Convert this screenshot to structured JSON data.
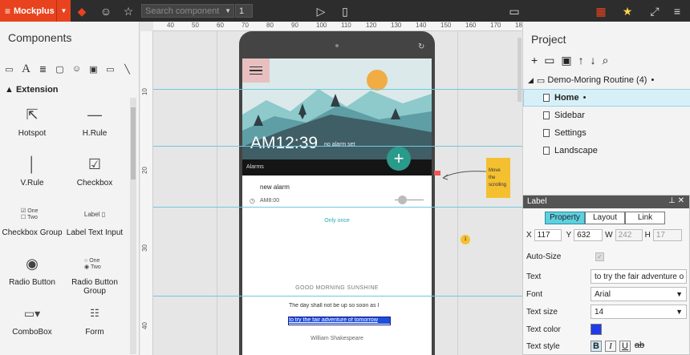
{
  "app": {
    "name": "Mockplus"
  },
  "toolbar": {
    "search_placeholder": "Search component",
    "page_number": "1"
  },
  "left": {
    "title": "Components",
    "section": "Extension",
    "items": [
      {
        "label": "Hotspot",
        "icon": "cursor-icon"
      },
      {
        "label": "H.Rule",
        "icon": "hrule-icon"
      },
      {
        "label": "V.Rule",
        "icon": "vrule-icon"
      },
      {
        "label": "Checkbox",
        "icon": "checkbox-icon"
      },
      {
        "label": "Checkbox Group",
        "icon": "checkbox-group-icon"
      },
      {
        "label": "Label Text Input",
        "icon": "label-input-icon"
      },
      {
        "label": "Radio Button",
        "icon": "radio-icon"
      },
      {
        "label": "Radio Button Group",
        "icon": "radio-group-icon"
      },
      {
        "label": "ComboBox",
        "icon": "combobox-icon"
      },
      {
        "label": "Form",
        "icon": "form-icon"
      }
    ],
    "cbg_one": "One",
    "cbg_two": "Two",
    "label_word": "Label",
    "rbg_one": "One",
    "rbg_two": "Two"
  },
  "ruler": {
    "top": [
      "40",
      "50",
      "60",
      "70",
      "80",
      "90",
      "100",
      "110",
      "120",
      "130",
      "140",
      "150",
      "160",
      "170",
      "180"
    ],
    "left": [
      "10",
      "20",
      "30",
      "40"
    ]
  },
  "phone": {
    "time": "AM12:39",
    "no_alarm": "no alarm set",
    "alarms_bar": "Alarms",
    "new_alarm": "new alarm",
    "alarm_time": "AM8:00",
    "only_once": "Only once",
    "headline": "GOOD MORNING SUNSHINE",
    "quote1": "The day shall not be up so soon as I",
    "quote2": "to try the fair adventure of tomorrow",
    "author": "William Shakespeare",
    "fab": "+"
  },
  "note": {
    "text": "Move the scrolling"
  },
  "badge": "1",
  "project": {
    "title": "Project",
    "root": "Demo-Moring Routine (4)",
    "pages": [
      "Home",
      "Sidebar",
      "Settings",
      "Landscape"
    ],
    "selected": "Home"
  },
  "label_panel": {
    "title": "Label",
    "tabs": [
      "Property",
      "Layout",
      "Link"
    ],
    "x": "117",
    "y": "632",
    "w": "242",
    "h": "17",
    "autosize_label": "Auto-Size",
    "text_label": "Text",
    "text_value": "to try the fair adventure o",
    "font_label": "Font",
    "font_value": "Arial",
    "size_label": "Text size",
    "size_value": "14",
    "color_label": "Text color",
    "color_value": "#1f3ce8",
    "style_label": "Text style"
  }
}
